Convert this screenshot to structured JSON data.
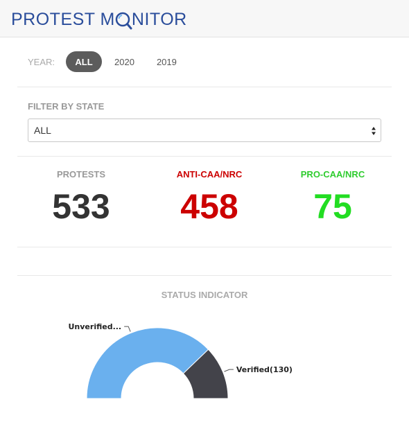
{
  "header": {
    "logo_text_before": "PROTEST M",
    "logo_text_after": "NITOR"
  },
  "year": {
    "label": "YEAR:",
    "options": [
      {
        "label": "ALL",
        "active": true
      },
      {
        "label": "2020",
        "active": false
      },
      {
        "label": "2019",
        "active": false
      }
    ]
  },
  "filter": {
    "label": "FILTER BY STATE",
    "selected": "ALL"
  },
  "stats": {
    "protests": {
      "label": "PROTESTS",
      "value": "533"
    },
    "anti": {
      "label": "ANTI-CAA/NRC",
      "value": "458"
    },
    "pro": {
      "label": "PRO-CAA/NRC",
      "value": "75"
    }
  },
  "status": {
    "title": "STATUS INDICATOR"
  },
  "colors": {
    "brand": "#2a4d9b",
    "anti": "#cc0000",
    "pro": "#22dd22",
    "unverified": "#6ab0ee",
    "verified": "#43434a"
  },
  "chart_data": {
    "type": "pie",
    "subtype": "half-donut",
    "title": "STATUS INDICATOR",
    "categories": [
      "Unverified...",
      "Verified(130)"
    ],
    "values": [
      403,
      130
    ],
    "colors": [
      "#6ab0ee",
      "#43434a"
    ]
  }
}
